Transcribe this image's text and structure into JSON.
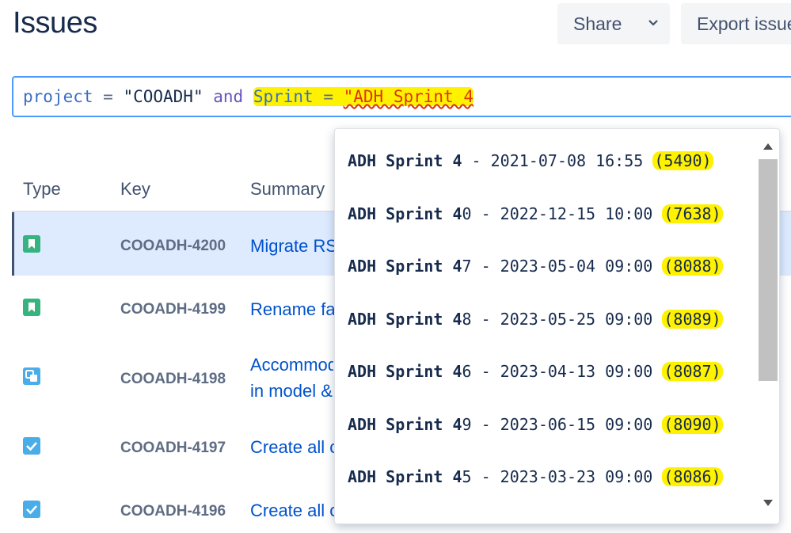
{
  "header": {
    "title": "Issues",
    "share_label": "Share",
    "export_label": "Export issues"
  },
  "jql": {
    "field1": "project",
    "op1": " = ",
    "value1": "\"COOADH\"",
    "keyword": " and ",
    "field2": "Sprint",
    "op2": " = ",
    "value2": "\"ADH Sprint 4"
  },
  "table": {
    "columns": [
      "Type",
      "Key",
      "Summary"
    ],
    "rows": [
      {
        "type": "story-icon",
        "key": "COOADH-4200",
        "summary": "Migrate RS"
      },
      {
        "type": "story-icon",
        "key": "COOADH-4199",
        "summary": "Rename fa"
      },
      {
        "type": "subtask-icon",
        "key": "COOADH-4198",
        "summary": "Accommod in model &",
        "trail": "a"
      },
      {
        "type": "task-icon",
        "key": "COOADH-4197",
        "summary": "Create all c"
      },
      {
        "type": "task-icon",
        "key": "COOADH-4196",
        "summary": "Create all c"
      }
    ]
  },
  "suggestions": [
    {
      "bold": "ADH Sprint 4",
      "rest": " - 2021-07-08 16:55 ",
      "count": "(5490)"
    },
    {
      "bold": "ADH Sprint 4",
      "rest": "0 - 2022-12-15 10:00 ",
      "count": "(7638)"
    },
    {
      "bold": "ADH Sprint 4",
      "rest": "7 - 2023-05-04 09:00 ",
      "count": "(8088)"
    },
    {
      "bold": "ADH Sprint 4",
      "rest": "8 - 2023-05-25 09:00 ",
      "count": "(8089)"
    },
    {
      "bold": "ADH Sprint 4",
      "rest": "6 - 2023-04-13 09:00 ",
      "count": "(8087)"
    },
    {
      "bold": "ADH Sprint 4",
      "rest": "9 - 2023-06-15 09:00 ",
      "count": "(8090)"
    },
    {
      "bold": "ADH Sprint 4",
      "rest": "5 - 2023-03-23 09:00 ",
      "count": "(8086)"
    }
  ],
  "colors": {
    "accent": "#0052cc",
    "highlight": "#fff200",
    "focus_border": "#4c9aff"
  }
}
